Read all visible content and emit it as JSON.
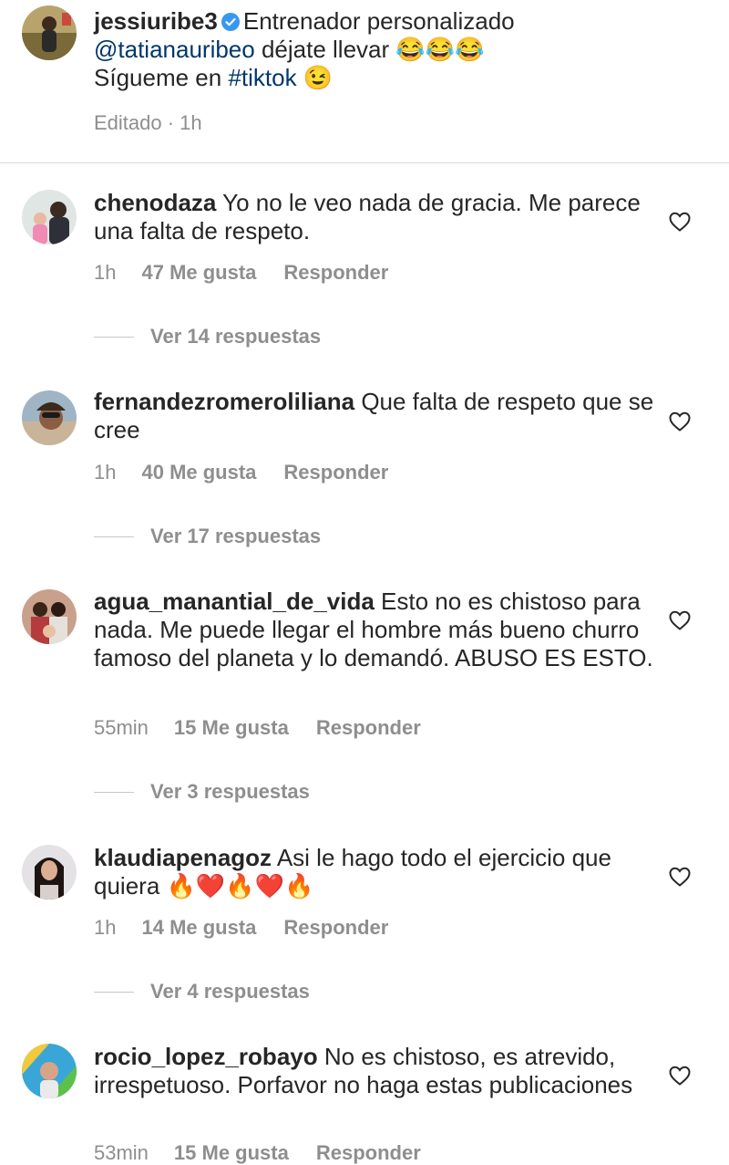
{
  "caption": {
    "username": "jessiuribe3",
    "text": "Entrenador personalizado",
    "mention": "@tatianauribeo",
    "line2_text": "déjate llevar",
    "line2_emojis": "😂😂😂",
    "line3_text": "Sígueme en",
    "hashtag": "#tiktok",
    "line3_emoji": "😉",
    "meta": "Editado · 1h"
  },
  "comments": [
    {
      "username": "chenodaza",
      "text": "Yo no le veo nada de gracia.  Me parece una falta de respeto.",
      "time": "1h",
      "likes": "47 Me gusta",
      "reply_label": "Responder",
      "view_replies": "Ver 14 respuestas"
    },
    {
      "username": "fernandezromeroliliana",
      "text": "Que falta de respeto que se cree",
      "time": "1h",
      "likes": "40 Me gusta",
      "reply_label": "Responder",
      "view_replies": "Ver 17 respuestas"
    },
    {
      "username": "agua_manantial_de_vida",
      "text": "Esto no es chistoso para nada.  Me puede llegar el hombre más bueno churro famoso del planeta y lo demandó.  ABUSO ES ESTO.",
      "time": "55min",
      "likes": "15 Me gusta",
      "reply_label": "Responder",
      "view_replies": "Ver 3 respuestas"
    },
    {
      "username": "klaudiapenagoz",
      "text": "Asi le hago todo el ejercicio que quiera",
      "emojis": "🔥❤️🔥❤️🔥",
      "time": "1h",
      "likes": "14 Me gusta",
      "reply_label": "Responder",
      "view_replies": "Ver 4 respuestas"
    },
    {
      "username": "rocio_lopez_robayo",
      "text": "No es chistoso, es atrevido, irrespetuoso. Porfavor no haga estas publicaciones",
      "time": "53min",
      "likes": "15 Me gusta",
      "reply_label": "Responder"
    }
  ],
  "colors": {
    "text": "#262626",
    "secondary": "#8e8e8e",
    "link": "#00376b",
    "verified": "#3897f0",
    "divider": "#dbdbdb"
  },
  "icons": [
    "verified-badge-icon",
    "heart-outline-icon"
  ]
}
